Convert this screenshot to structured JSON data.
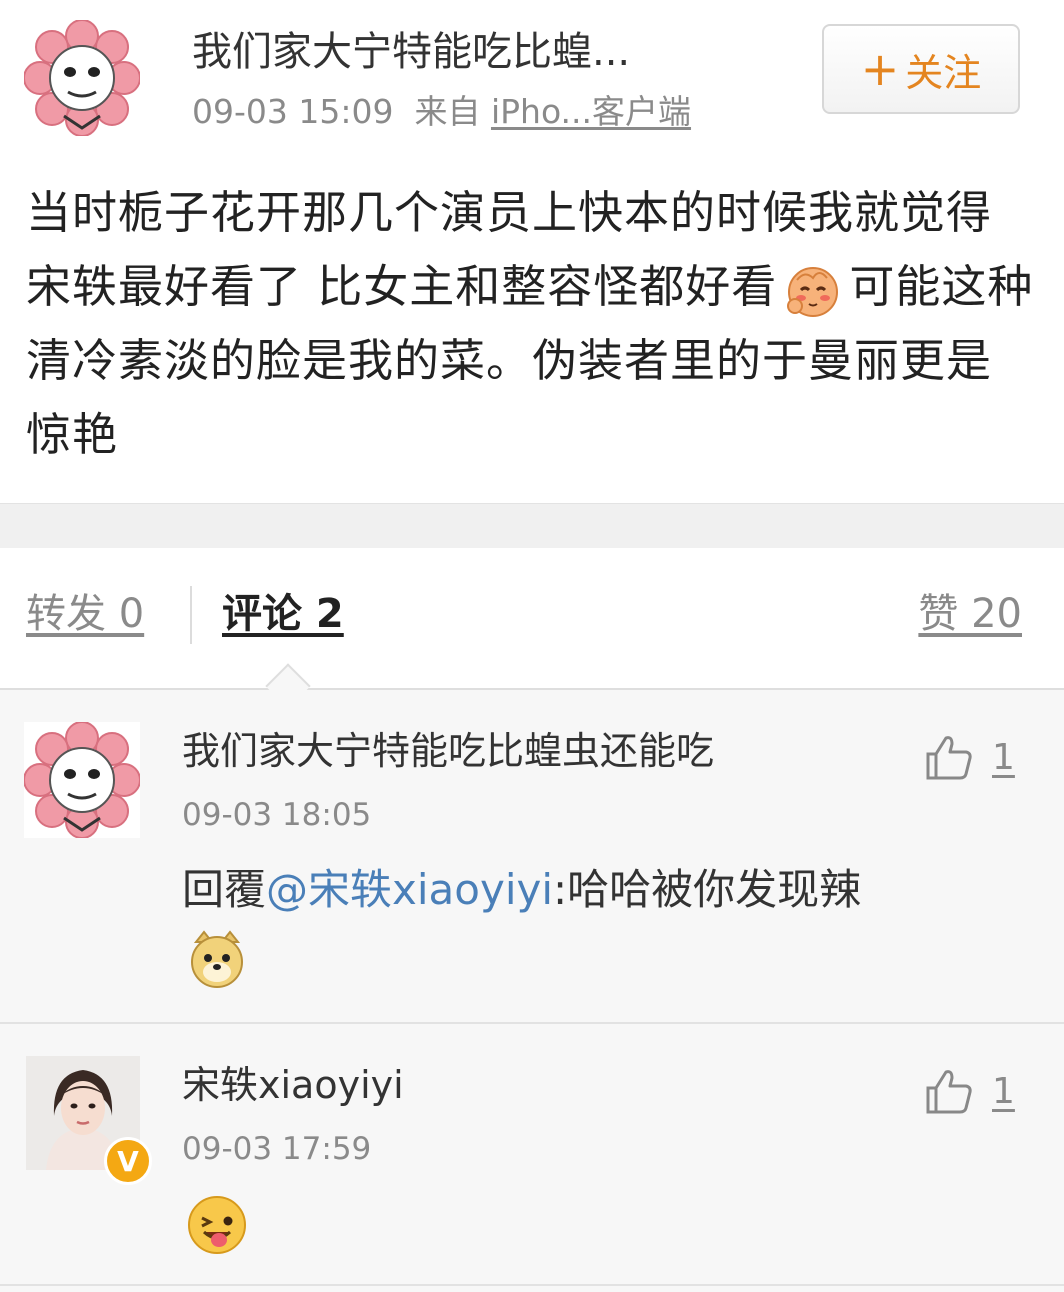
{
  "post": {
    "author": "我们家大宁特能吃比蝗...",
    "time": "09-03 15:09",
    "source_prefix": "来自",
    "source": "iPho...客户端",
    "follow_label": "关注",
    "text_part1": "当时栀子花开那几个演员上快本的时候我就觉得宋轶最好看了 比女主和整容怪都好看",
    "text_part2": "可能这种清冷素淡的脸是我的菜。伪装者里的于曼丽更是惊艳"
  },
  "tabs": {
    "repost": "转发 0",
    "comment": "评论 2",
    "like": "赞 20"
  },
  "comments": [
    {
      "author": "我们家大宁特能吃比蝗虫还能吃",
      "time": "09-03 18:05",
      "reply_prefix": "回覆",
      "mention": "@宋轶xiaoyiyi",
      "reply_text": ":哈哈被你发现辣",
      "likes": "1",
      "emoji": "doge-emoji"
    },
    {
      "author": "宋轶xiaoyiyi",
      "time": "09-03 17:59",
      "likes": "1",
      "emoji": "tongue-wink-emoji",
      "badge": "V"
    }
  ],
  "colors": {
    "follow_text": "#e48520",
    "mention": "#4a7fb8",
    "verified_badge": "#f4a813",
    "flower_petal": "#f09aa6"
  }
}
